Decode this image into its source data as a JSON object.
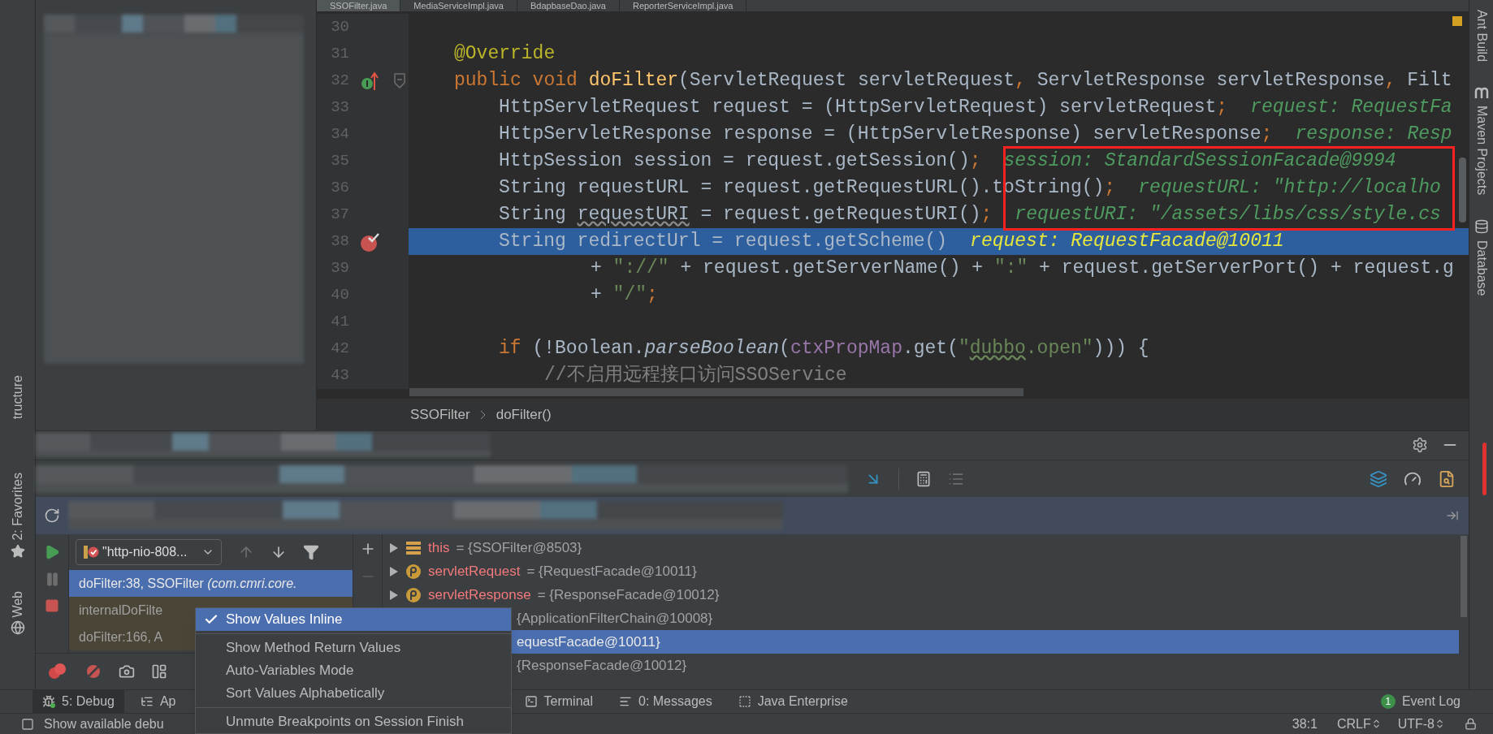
{
  "editor_tabs": [
    {
      "label": "SSOFilter.java",
      "selected": true
    },
    {
      "label": "MediaServiceImpl.java",
      "selected": false
    },
    {
      "label": "BdapbaseDao.java",
      "selected": false
    },
    {
      "label": "ReporterServiceImpl.java",
      "selected": false
    }
  ],
  "editor": {
    "lines": [
      {
        "number": "30",
        "kind": "blank",
        "current": false
      },
      {
        "number": "31",
        "kind": "member",
        "current": false,
        "tokens": [
          {
            "kind": "annotation",
            "text": "@Override"
          }
        ]
      },
      {
        "number": "32",
        "kind": "member",
        "current": false,
        "gutter_icon": {
          "kind": "override"
        },
        "tokens": [
          {
            "kind": "keyword",
            "text": "public void "
          },
          {
            "kind": "method",
            "text": "doFilter"
          },
          {
            "kind": "plain",
            "text": "(ServletRequest servletRequest"
          },
          {
            "kind": "keyword",
            "text": ", "
          },
          {
            "kind": "plain",
            "text": "ServletResponse servletResponse"
          },
          {
            "kind": "keyword",
            "text": ", "
          },
          {
            "kind": "plain",
            "text": "Filt"
          }
        ]
      },
      {
        "number": "33",
        "kind": "body",
        "current": false,
        "tokens": [
          {
            "kind": "plain",
            "text": "HttpServletRequest request = (HttpServletRequest) servletRequest"
          },
          {
            "kind": "keyword",
            "text": ";"
          }
        ],
        "hint": "request: RequestFa"
      },
      {
        "number": "34",
        "kind": "body",
        "current": false,
        "tokens": [
          {
            "kind": "plain",
            "text": "HttpServletResponse response = (HttpServletResponse) servletResponse"
          },
          {
            "kind": "keyword",
            "text": ";"
          }
        ],
        "hint": "response: Resp"
      },
      {
        "number": "35",
        "kind": "body",
        "current": false,
        "tokens": [
          {
            "kind": "plain",
            "text": "HttpSession session = request.getSession()"
          },
          {
            "kind": "keyword",
            "text": ";"
          }
        ],
        "hint": "session: StandardSessionFacade@9994"
      },
      {
        "number": "36",
        "kind": "body",
        "current": false,
        "tokens": [
          {
            "kind": "plain",
            "text": "String requestURL = request.getRequestURL().toString()"
          },
          {
            "kind": "keyword",
            "text": ";"
          }
        ],
        "hint": "requestURL: \"http://localho"
      },
      {
        "number": "37",
        "kind": "body",
        "current": false,
        "tokens": [
          {
            "kind": "plain",
            "text": "String "
          },
          {
            "kind": "wavy",
            "text": "requestURI"
          },
          {
            "kind": "plain",
            "text": " = request.getRequestURI()"
          },
          {
            "kind": "keyword",
            "text": ";"
          }
        ],
        "hint": "requestURI: \"/assets/libs/css/style.cs"
      },
      {
        "number": "38",
        "kind": "body",
        "current": true,
        "gutter_icon": {
          "kind": "breakpoint"
        },
        "tokens": [
          {
            "kind": "plain",
            "text": "String redirectUrl = request.getScheme()"
          }
        ],
        "hint": "request: RequestFacade@10011"
      },
      {
        "number": "39",
        "kind": "continuation",
        "current": false,
        "tokens": [
          {
            "kind": "plain",
            "text": "+ "
          },
          {
            "kind": "string",
            "text": "\"://\""
          },
          {
            "kind": "plain",
            "text": " + request.getServerName() + "
          },
          {
            "kind": "string",
            "text": "\":\""
          },
          {
            "kind": "plain",
            "text": " + request.getServerPort() + request.g"
          }
        ]
      },
      {
        "number": "40",
        "kind": "continuation",
        "current": false,
        "tokens": [
          {
            "kind": "plain",
            "text": "+ "
          },
          {
            "kind": "string",
            "text": "\"/\""
          },
          {
            "kind": "keyword",
            "text": ";"
          }
        ]
      },
      {
        "number": "41",
        "kind": "blank",
        "current": false
      },
      {
        "number": "42",
        "kind": "body",
        "current": false,
        "tokens": [
          {
            "kind": "keyword",
            "text": "if "
          },
          {
            "kind": "plain",
            "text": "(!Boolean."
          },
          {
            "kind": "static",
            "text": "parseBoolean"
          },
          {
            "kind": "plain",
            "text": "("
          },
          {
            "kind": "field",
            "text": "ctxPropMap"
          },
          {
            "kind": "plain",
            "text": ".get("
          },
          {
            "kind": "string",
            "text": "\""
          },
          {
            "kind": "string_wavy",
            "text": "dubbo"
          },
          {
            "kind": "string",
            "text": ".open\""
          },
          {
            "kind": "plain",
            "text": "))) {"
          }
        ]
      },
      {
        "number": "43",
        "kind": "nested",
        "current": false,
        "tokens": [
          {
            "kind": "comment",
            "text": "//不启用远程接口访问SSOService"
          }
        ]
      }
    ]
  },
  "breadcrumb": [
    "SSOFilter",
    "doFilter()"
  ],
  "left_tool_strip": [
    {
      "label": "tructure",
      "kind": "text"
    },
    {
      "label": "2: Favorites",
      "kind": "favorites"
    },
    {
      "label": "Web",
      "kind": "web"
    }
  ],
  "right_tool_strip": [
    {
      "label": "Ant Build",
      "kind": "text"
    },
    {
      "label": "Maven Projects",
      "kind": "maven"
    },
    {
      "label": "Database",
      "kind": "database"
    }
  ],
  "debug": {
    "thread": "\"http-nio-808...",
    "frames": [
      {
        "text": "doFilter:38, SSOFilter *(com.cmri.core.*",
        "selected": true,
        "library": false
      },
      {
        "text": "internalDoFilte",
        "selected": false,
        "library": true
      },
      {
        "text": "doFilter:166, A",
        "selected": false,
        "library": true
      }
    ],
    "variables": [
      {
        "kind": "field",
        "name": "this",
        "value": "= {SSOFilter@8503}",
        "selected": false
      },
      {
        "kind": "param",
        "name": "servletRequest",
        "value": "= {RequestFacade@10011}",
        "selected": false
      },
      {
        "kind": "param",
        "name": "servletResponse",
        "value": "= {ResponseFacade@10012}",
        "selected": false
      },
      {
        "kind": "covered",
        "value": "{ApplicationFilterChain@10008}",
        "selected": false
      },
      {
        "kind": "covered",
        "value": "equestFacade@10011}",
        "selected": true
      },
      {
        "kind": "covered",
        "value": "{ResponseFacade@10012}",
        "selected": false
      }
    ]
  },
  "context_menu": [
    {
      "kind": "item",
      "label": "Show Values Inline",
      "checked": true,
      "selected": true
    },
    {
      "kind": "separator"
    },
    {
      "kind": "item",
      "label": "Show Method Return Values",
      "checked": false,
      "selected": false
    },
    {
      "kind": "item",
      "label": "Auto-Variables Mode",
      "checked": false,
      "selected": false
    },
    {
      "kind": "item",
      "label": "Sort Values Alphabetically",
      "checked": false,
      "selected": false
    },
    {
      "kind": "separator"
    },
    {
      "kind": "item",
      "label": "Unmute Breakpoints on Session Finish",
      "checked": false,
      "selected": false
    }
  ],
  "tool_windows": [
    {
      "label": "5: Debug",
      "kind": "bug",
      "selected": true
    },
    {
      "label": "Ap",
      "kind": "app",
      "selected": false
    },
    {
      "label": "Terminal",
      "kind": "terminal",
      "selected": false
    },
    {
      "label": "0: Messages",
      "kind": "messages",
      "selected": false
    },
    {
      "label": "Java Enterprise",
      "kind": "enterprise",
      "selected": false
    }
  ],
  "event_log": {
    "label": "Event Log",
    "badge": "1"
  },
  "status_bar": {
    "message": "Show available debu",
    "position": "38:1",
    "line_separator": "CRLF",
    "encoding": "UTF-8"
  }
}
